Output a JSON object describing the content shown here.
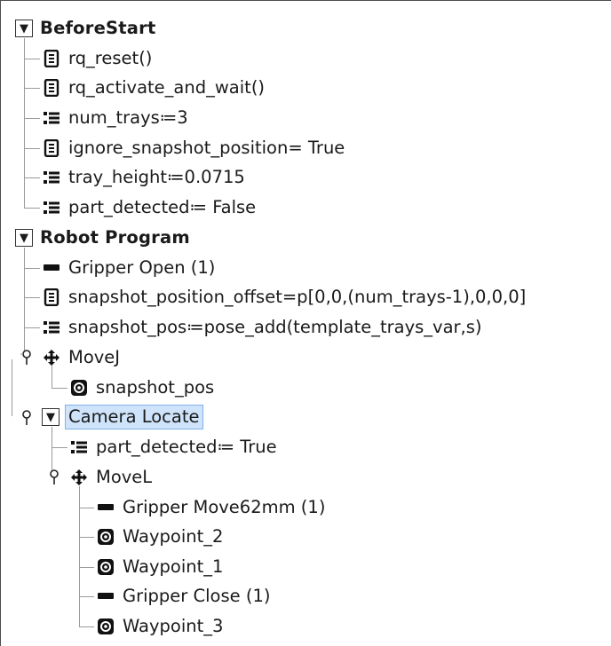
{
  "tree": {
    "nodes": [
      {
        "label": "BeforeStart",
        "icon": "expand-toggle",
        "bold": true
      },
      {
        "label": "rq_reset()",
        "icon": "script-icon"
      },
      {
        "label": "rq_activate_and_wait()",
        "icon": "script-icon"
      },
      {
        "label": "num_trays≔3",
        "icon": "assignment-icon"
      },
      {
        "label": "ignore_snapshot_position= True",
        "icon": "script-icon"
      },
      {
        "label": "tray_height≔0.0715",
        "icon": "assignment-icon"
      },
      {
        "label": "part_detected≔ False",
        "icon": "assignment-icon"
      },
      {
        "label": "Robot Program",
        "icon": "expand-toggle",
        "bold": true
      },
      {
        "label": "Gripper Open (1)",
        "icon": "gripper-icon"
      },
      {
        "label": "snapshot_position_offset=p[0,0,(num_trays-1),0,0,0]",
        "icon": "script-icon"
      },
      {
        "label": "snapshot_pos≔pose_add(template_trays_var,s)",
        "icon": "assignment-icon"
      },
      {
        "label": "MoveJ",
        "icon": "move-icon"
      },
      {
        "label": "snapshot_pos",
        "icon": "waypoint-icon"
      },
      {
        "label": "Camera Locate",
        "icon": "expand-toggle",
        "selected": true
      },
      {
        "label": "part_detected≔ True",
        "icon": "assignment-icon"
      },
      {
        "label": "MoveL",
        "icon": "move-icon"
      },
      {
        "label": "Gripper Move62mm (1)",
        "icon": "gripper-icon"
      },
      {
        "label": "Waypoint_2",
        "icon": "waypoint-icon"
      },
      {
        "label": "Waypoint_1",
        "icon": "waypoint-icon"
      },
      {
        "label": "Gripper Close (1)",
        "icon": "gripper-icon"
      },
      {
        "label": "Waypoint_3",
        "icon": "waypoint-icon"
      }
    ],
    "toggle_glyph": "▼"
  }
}
